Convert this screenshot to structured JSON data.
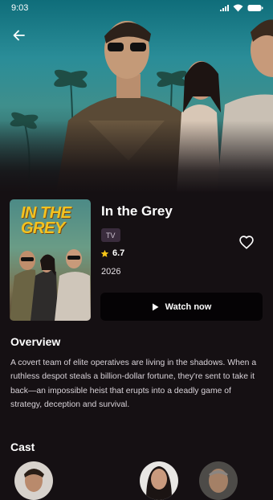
{
  "status_bar": {
    "time": "9:03"
  },
  "movie": {
    "title": "In the Grey",
    "type_badge": "TV",
    "rating": "6.7",
    "year": "2026",
    "poster_title": "IN THE GREY"
  },
  "actions": {
    "watch_label": "Watch now"
  },
  "overview": {
    "heading": "Overview",
    "text": "A covert team of elite operatives are living in the shadows. When a ruthless despot steals a billion-dollar fortune, they're sent to take it back—an impossible heist that erupts into a deadly game of strategy, deception and survival."
  },
  "cast": {
    "heading": "Cast"
  },
  "colors": {
    "accent_star": "#f5c518",
    "background": "#151013",
    "button": "#050305"
  },
  "icons": [
    "back-arrow-icon",
    "heart-icon",
    "star-icon",
    "play-icon",
    "signal-icon",
    "wifi-icon",
    "battery-icon"
  ]
}
